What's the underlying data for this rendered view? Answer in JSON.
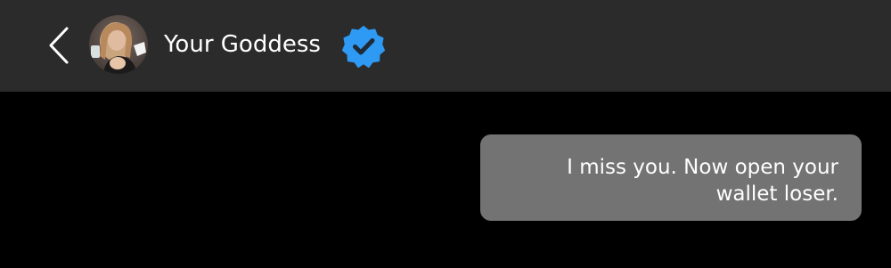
{
  "header": {
    "back_icon": "chevron-left-icon",
    "contact_name": "Your Goddess",
    "verified_icon": "verified-badge-icon",
    "verified_color": "#2f9af3",
    "background": "#2b2b2b"
  },
  "chat": {
    "background": "#000000",
    "messages": [
      {
        "direction": "outgoing",
        "lines": [
          "I miss you. Now open your",
          "wallet loser."
        ],
        "bubble_color": "#737373"
      }
    ]
  }
}
